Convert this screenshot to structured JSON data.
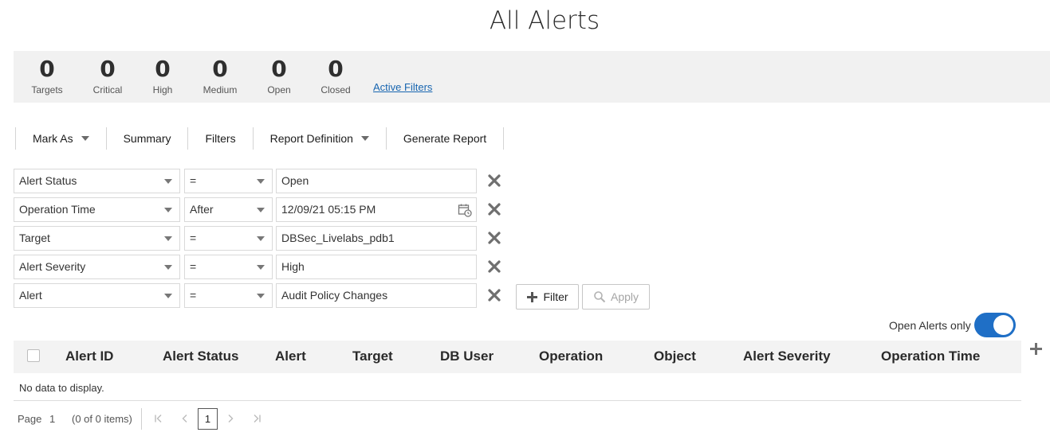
{
  "page": {
    "title": "All Alerts"
  },
  "stats": [
    {
      "value": "0",
      "label": "Targets"
    },
    {
      "value": "0",
      "label": "Critical"
    },
    {
      "value": "0",
      "label": "High"
    },
    {
      "value": "0",
      "label": "Medium"
    },
    {
      "value": "0",
      "label": "Open"
    },
    {
      "value": "0",
      "label": "Closed"
    }
  ],
  "active_filters_link": "Active Filters",
  "toolbar": {
    "mark_as": "Mark As",
    "summary": "Summary",
    "filters": "Filters",
    "report_definition": "Report Definition",
    "generate_report": "Generate Report"
  },
  "filters": [
    {
      "field": "Alert Status",
      "operator": "=",
      "value": "Open"
    },
    {
      "field": "Operation Time",
      "operator": "After",
      "value": "12/09/21 05:15 PM"
    },
    {
      "field": "Target",
      "operator": "=",
      "value": "DBSec_Livelabs_pdb1"
    },
    {
      "field": "Alert Severity",
      "operator": "=",
      "value": "High"
    },
    {
      "field": "Alert",
      "operator": "=",
      "value": "Audit Policy Changes"
    }
  ],
  "filter_button": "Filter",
  "apply_button": "Apply",
  "open_alerts_toggle": {
    "label": "Open Alerts only",
    "on": true
  },
  "table": {
    "columns": [
      "Alert ID",
      "Alert Status",
      "Alert",
      "Target",
      "DB User",
      "Operation",
      "Object",
      "Alert Severity",
      "Operation Time"
    ],
    "empty_message": "No data to display."
  },
  "pagination": {
    "page_label": "Page",
    "page": "1",
    "items": "(0 of 0 items)",
    "current": "1"
  },
  "colors": {
    "accent": "#1f6fc6",
    "link": "#1765b0"
  }
}
